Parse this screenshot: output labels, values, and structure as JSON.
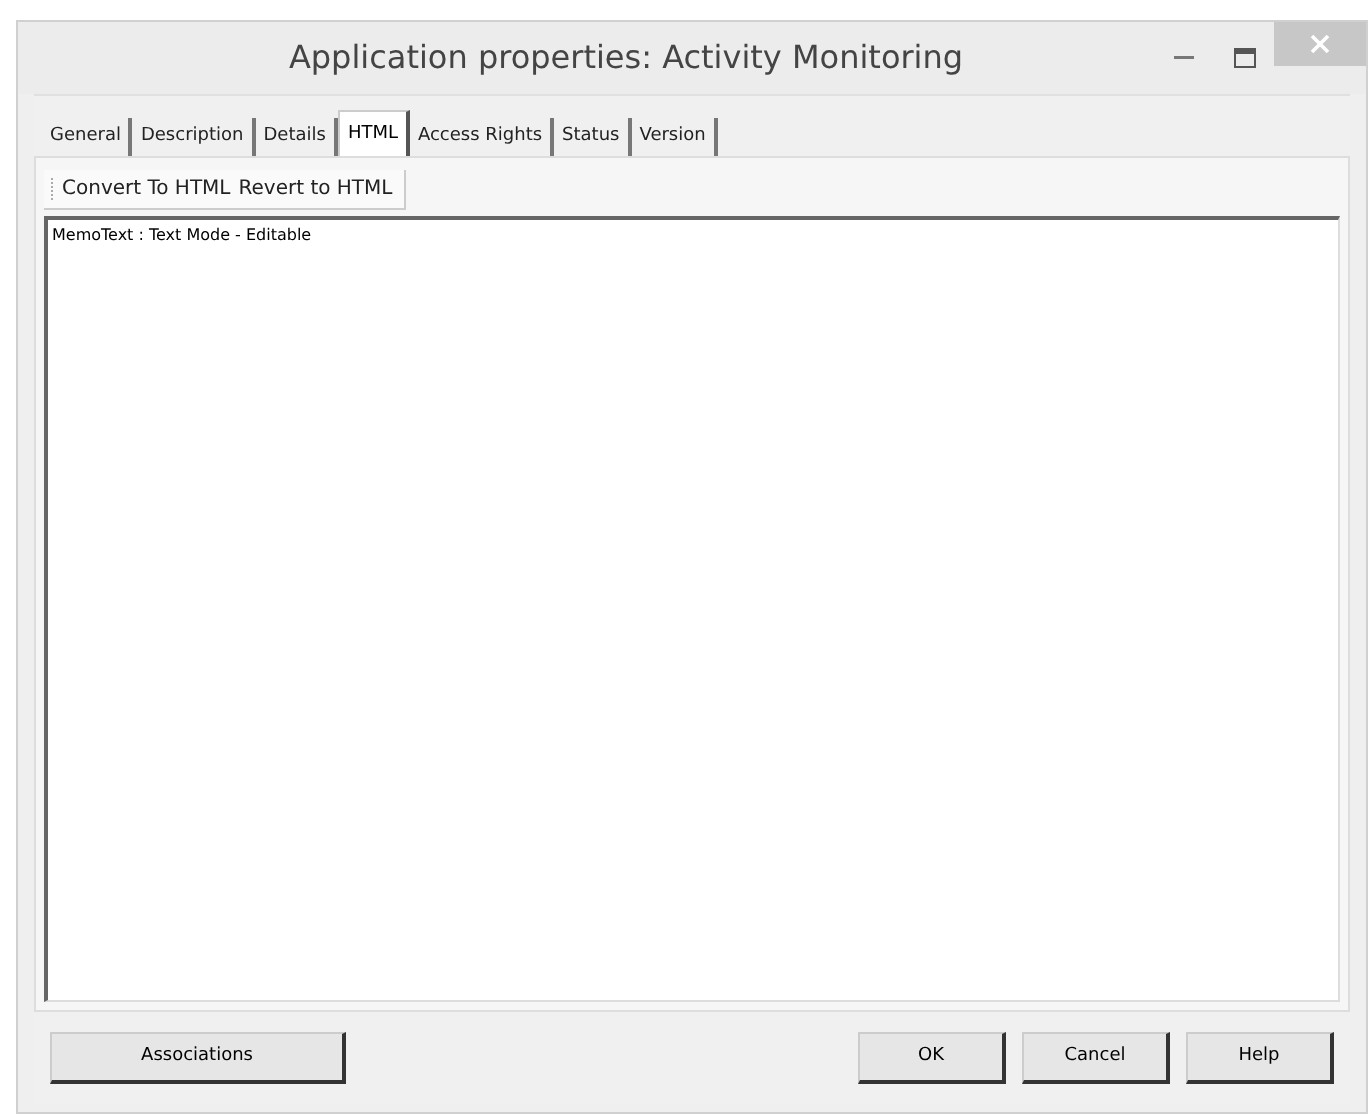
{
  "window": {
    "title": "Application properties: Activity Monitoring"
  },
  "tabs": [
    {
      "label": "General",
      "selected": false
    },
    {
      "label": "Description",
      "selected": false
    },
    {
      "label": "Details",
      "selected": false
    },
    {
      "label": "HTML",
      "selected": true
    },
    {
      "label": "Access Rights",
      "selected": false
    },
    {
      "label": "Status",
      "selected": false
    },
    {
      "label": "Version",
      "selected": false
    }
  ],
  "toolbar": [
    "Convert To HTML",
    "Revert to HTML"
  ],
  "memo": {
    "value": "MemoText : Text Mode - Editable"
  },
  "buttons_left": [
    "Associations"
  ],
  "buttons_right": [
    "OK",
    "Cancel",
    "Help"
  ]
}
